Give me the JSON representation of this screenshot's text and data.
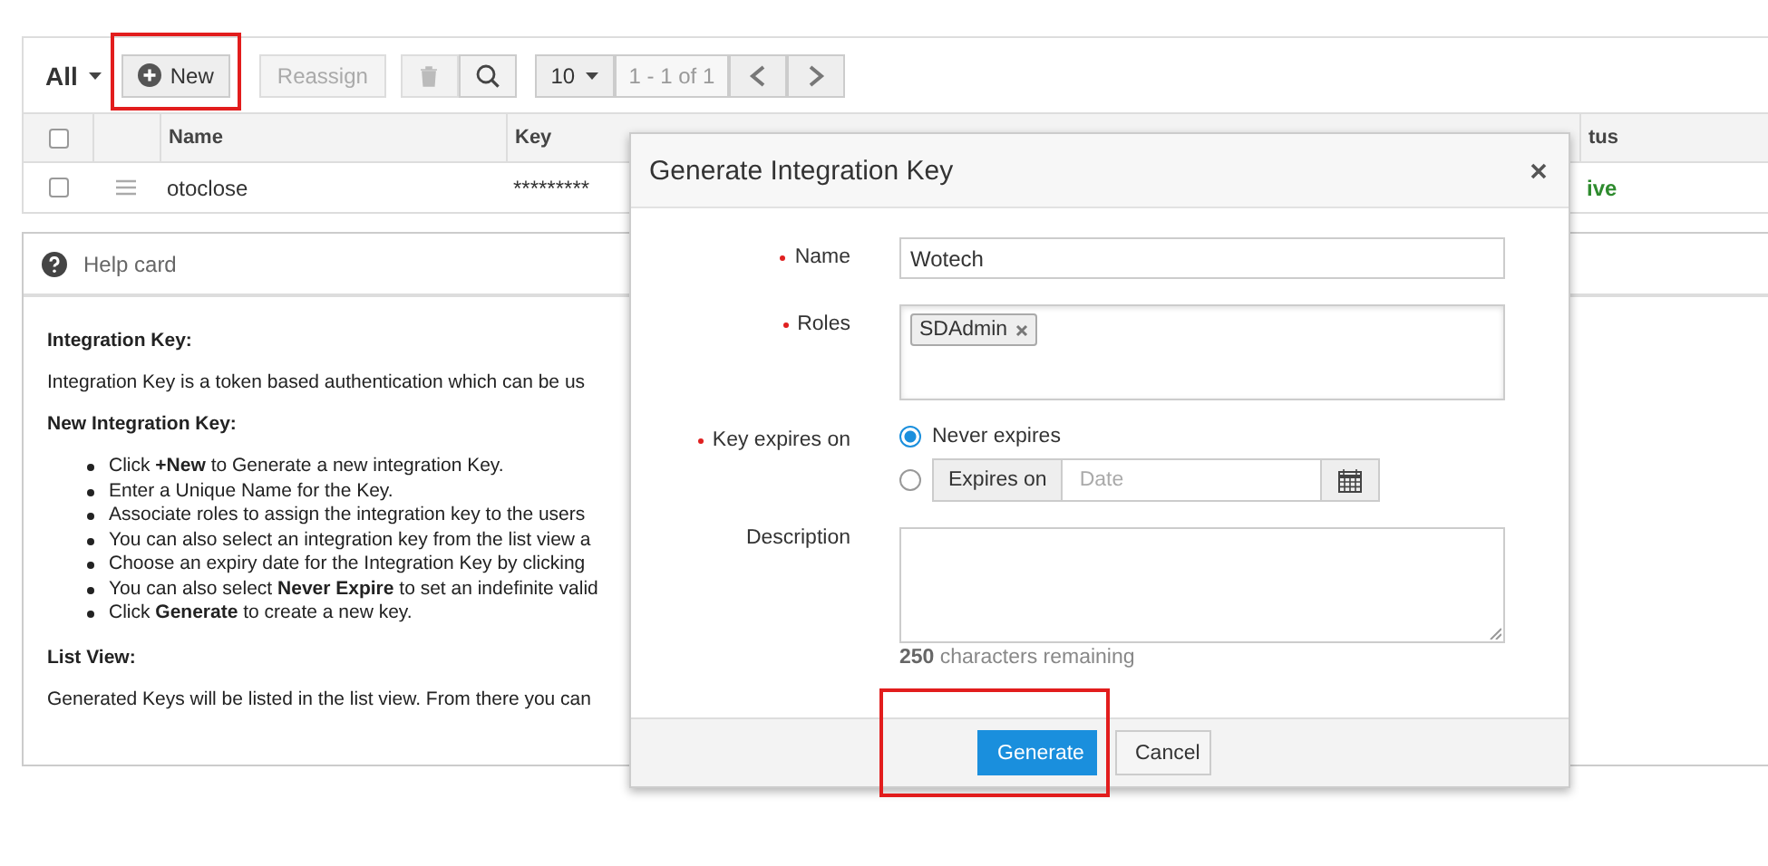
{
  "toolbar": {
    "view_filter": "All",
    "new_button": {
      "label": "New",
      "highlighted": true
    },
    "reassign_button": {
      "label": "Reassign",
      "disabled": true
    },
    "delete_disabled": true,
    "page_size": "10",
    "page_range": "1 - 1 of 1"
  },
  "table": {
    "select_all_checked": false,
    "columns": [
      "Name",
      "Key",
      "tus"
    ],
    "rows": [
      {
        "checked": false,
        "name": "otoclose",
        "key": "*********",
        "status": "ive"
      }
    ]
  },
  "help_card": {
    "title": "Help card",
    "sections": [
      {
        "heading": "Integration Key:",
        "paragraph": "Integration Key is a token based authentication which can be us"
      },
      {
        "heading": "New Integration Key:",
        "bullets": [
          "Click **+New** to Generate a new integration Key.",
          "Enter a Unique Name for the Key.",
          "Associate roles to assign the integration key to the users",
          "You can also select an integration key from the list view a",
          "Choose an expiry date for the Integration Key by clicking",
          "You can also select **Never Expire** to set an indefinite valid",
          "Click **Generate** to create a new key."
        ]
      },
      {
        "heading": "List View:",
        "paragraph": "Generated Keys will be listed in the list view. From there you can"
      }
    ]
  },
  "dialog": {
    "title": "Generate Integration Key",
    "fields": [
      {
        "kind": "text",
        "label": "Name",
        "required": true,
        "value": "Wotech"
      },
      {
        "kind": "tags",
        "label": "Roles",
        "required": true,
        "tags": [
          "SDAdmin"
        ]
      },
      {
        "kind": "expiry",
        "label": "Key expires on",
        "required": true,
        "options": [
          {
            "label": "Never expires",
            "selected": true
          },
          {
            "label": "Expires on",
            "selected": false,
            "placeholder": "Date"
          }
        ]
      },
      {
        "kind": "textarea",
        "label": "Description",
        "required": false,
        "remaining_count": "250",
        "remaining_text": "characters remaining"
      }
    ],
    "buttons": [
      {
        "label": "Generate",
        "kind": "primary",
        "highlighted": true
      },
      {
        "label": "Cancel",
        "kind": "secondary",
        "highlighted": false
      }
    ]
  }
}
